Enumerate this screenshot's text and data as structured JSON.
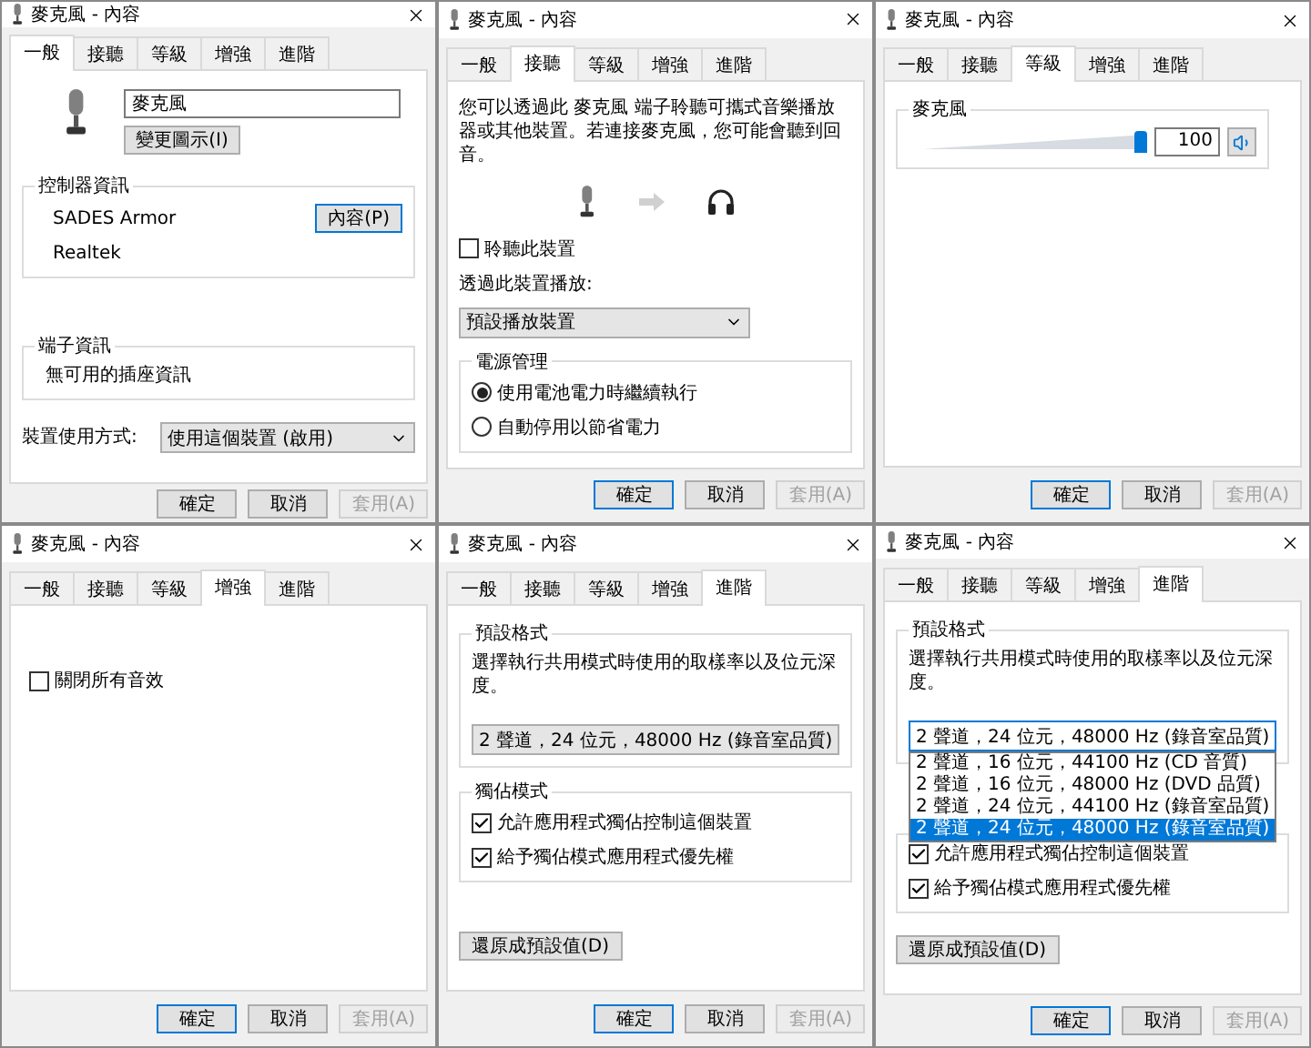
{
  "dialogs": [
    {
      "kind": "general",
      "title": "麥克風 - 內容",
      "tabs": [
        {
          "label": "一般",
          "selected": true
        },
        {
          "label": "接聽",
          "selected": false
        },
        {
          "label": "等級",
          "selected": false
        },
        {
          "label": "增強",
          "selected": false
        },
        {
          "label": "進階",
          "selected": false
        }
      ],
      "name_value": "麥克風",
      "change_icon_button": "變更圖示(I)",
      "controller": {
        "title": "控制器資訊",
        "name": "SADES Armor",
        "vendor": "Realtek",
        "properties_button": {
          "label": "內容(P)",
          "focused": true
        }
      },
      "jack": {
        "title": "端子資訊",
        "text": "無可用的插座資訊"
      },
      "usage": {
        "label": "裝置使用方式:",
        "value": "使用這個裝置 (啟用)"
      },
      "buttons": [
        {
          "label": "確定",
          "focused": false,
          "disabled": false
        },
        {
          "label": "取消",
          "focused": false,
          "disabled": false
        },
        {
          "label": "套用(A)",
          "focused": false,
          "disabled": true
        }
      ]
    },
    {
      "kind": "listen",
      "title": "麥克風 - 內容",
      "tabs": [
        {
          "label": "一般",
          "selected": false
        },
        {
          "label": "接聽",
          "selected": true
        },
        {
          "label": "等級",
          "selected": false
        },
        {
          "label": "增強",
          "selected": false
        },
        {
          "label": "進階",
          "selected": false
        }
      ],
      "description": "您可以透過此 麥克風 端子聆聽可攜式音樂播放器或其他裝置。若連接麥克風，您可能會聽到回音。",
      "listen_checkbox": {
        "label": "聆聽此裝置",
        "checked": false
      },
      "playback_label": "透過此裝置播放:",
      "playback_select": "預設播放裝置",
      "power": {
        "title": "電源管理",
        "options": [
          {
            "label": "使用電池電力時繼續執行",
            "selected": true
          },
          {
            "label": "自動停用以節省電力",
            "selected": false
          }
        ]
      },
      "buttons": [
        {
          "label": "確定",
          "focused": true,
          "disabled": false
        },
        {
          "label": "取消",
          "focused": false,
          "disabled": false
        },
        {
          "label": "套用(A)",
          "focused": false,
          "disabled": true
        }
      ]
    },
    {
      "kind": "levels",
      "title": "麥克風 - 內容",
      "tabs": [
        {
          "label": "一般",
          "selected": false
        },
        {
          "label": "接聽",
          "selected": false
        },
        {
          "label": "等級",
          "selected": true
        },
        {
          "label": "增強",
          "selected": false
        },
        {
          "label": "進階",
          "selected": false
        }
      ],
      "group_title": "麥克風",
      "level": 1.0,
      "value": "100",
      "buttons": [
        {
          "label": "確定",
          "focused": true,
          "disabled": false
        },
        {
          "label": "取消",
          "focused": false,
          "disabled": false
        },
        {
          "label": "套用(A)",
          "focused": false,
          "disabled": true
        }
      ]
    },
    {
      "kind": "enhancements",
      "title": "麥克風 - 內容",
      "tabs": [
        {
          "label": "一般",
          "selected": false
        },
        {
          "label": "接聽",
          "selected": false
        },
        {
          "label": "等級",
          "selected": false
        },
        {
          "label": "增強",
          "selected": true
        },
        {
          "label": "進階",
          "selected": false
        }
      ],
      "checkbox": {
        "label": "關閉所有音效",
        "checked": false
      },
      "buttons": [
        {
          "label": "確定",
          "focused": true,
          "disabled": false
        },
        {
          "label": "取消",
          "focused": false,
          "disabled": false
        },
        {
          "label": "套用(A)",
          "focused": false,
          "disabled": true
        }
      ]
    },
    {
      "kind": "advanced",
      "title": "麥克風 - 內容",
      "tabs": [
        {
          "label": "一般",
          "selected": false
        },
        {
          "label": "接聽",
          "selected": false
        },
        {
          "label": "等級",
          "selected": false
        },
        {
          "label": "增強",
          "selected": false
        },
        {
          "label": "進階",
          "selected": true
        }
      ],
      "default_format": {
        "title": "預設格式",
        "description": "選擇執行共用模式時使用的取樣率以及位元深度。",
        "select_value": "2 聲道，24 位元，48000 Hz (錄音室品質)"
      },
      "exclusive": {
        "title": "獨佔模式",
        "checkboxes": [
          {
            "label": "允許應用程式獨佔控制這個裝置",
            "checked": true
          },
          {
            "label": "給予獨佔模式應用程式優先權",
            "checked": true
          }
        ]
      },
      "restore_button": "還原成預設值(D)",
      "buttons": [
        {
          "label": "確定",
          "focused": true,
          "disabled": false
        },
        {
          "label": "取消",
          "focused": false,
          "disabled": false
        },
        {
          "label": "套用(A)",
          "focused": false,
          "disabled": true
        }
      ]
    },
    {
      "kind": "advanced",
      "title": "麥克風 - 內容",
      "tabs": [
        {
          "label": "一般",
          "selected": false
        },
        {
          "label": "接聽",
          "selected": false
        },
        {
          "label": "等級",
          "selected": false
        },
        {
          "label": "增強",
          "selected": false
        },
        {
          "label": "進階",
          "selected": true
        }
      ],
      "default_format": {
        "title": "預設格式",
        "description": "選擇執行共用模式時使用的取樣率以及位元深度。",
        "select_value": "2 聲道，24 位元，48000 Hz (錄音室品質)",
        "dropdown_options": [
          {
            "label": "2 聲道，16 位元，44100 Hz (CD 音質)",
            "selected": false
          },
          {
            "label": "2 聲道，16 位元，48000 Hz (DVD 品質)",
            "selected": false
          },
          {
            "label": "2 聲道，24 位元，44100 Hz (錄音室品質)",
            "selected": false
          },
          {
            "label": "2 聲道，24 位元，48000 Hz (錄音室品質)",
            "selected": true
          }
        ]
      },
      "exclusive": {
        "checkboxes": [
          {
            "label": "允許應用程式獨佔控制這個裝置",
            "checked": true
          },
          {
            "label": "給予獨佔模式應用程式優先權",
            "checked": true
          }
        ]
      },
      "restore_button": "還原成預設值(D)",
      "buttons": [
        {
          "label": "確定",
          "focused": true,
          "disabled": false
        },
        {
          "label": "取消",
          "focused": false,
          "disabled": false
        },
        {
          "label": "套用(A)",
          "focused": false,
          "disabled": true
        }
      ]
    }
  ]
}
